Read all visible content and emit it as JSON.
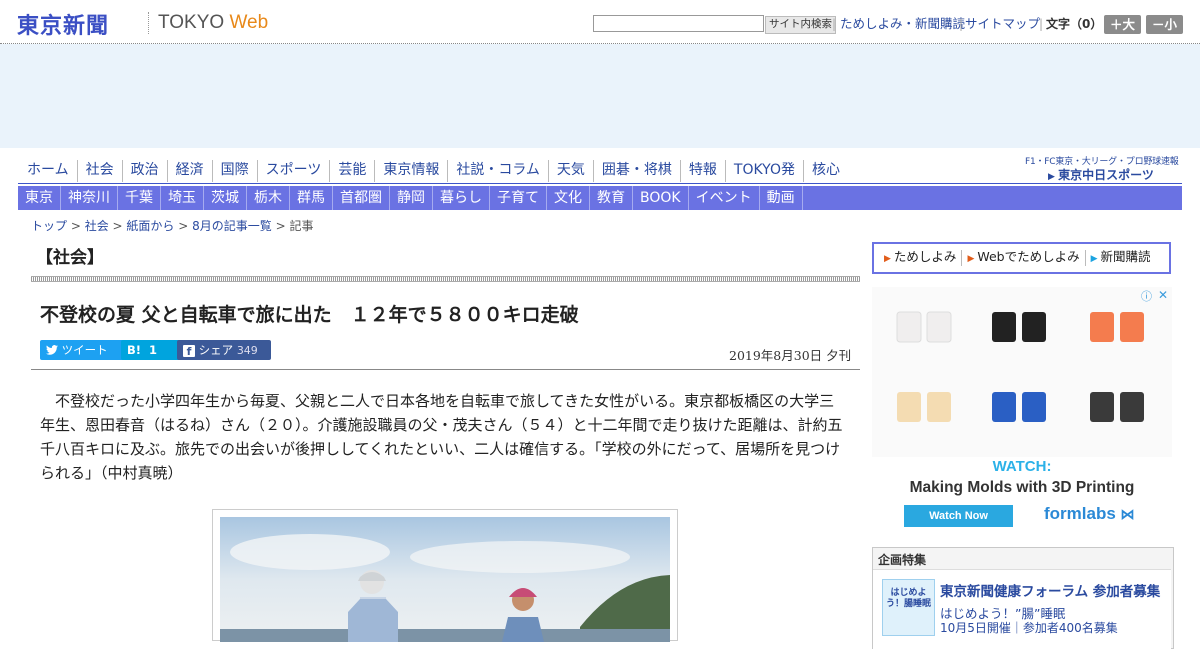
{
  "header": {
    "logo_jp": "東京新聞",
    "logo_en_1": "TOKYO",
    "logo_en_2": " Web",
    "search_placeholder": "",
    "search_button": "サイト内検索",
    "links": [
      "ためしよみ・新聞購読",
      "サイトマップ"
    ],
    "font_label": "文字（0）",
    "font_bigger": "＋大",
    "font_smaller": "－小"
  },
  "nav_primary": [
    "ホーム",
    "社会",
    "政治",
    "経済",
    "国際",
    "スポーツ",
    "芸能",
    "東京情報",
    "社説・コラム",
    "天気",
    "囲碁・将棋",
    "特報",
    "TOKYO発",
    "核心"
  ],
  "nav_regional": [
    "東京",
    "神奈川",
    "千葉",
    "埼玉",
    "茨城",
    "栃木",
    "群馬",
    "首都圏",
    "静岡",
    "暮らし",
    "子育て",
    "文化",
    "教育",
    "BOOK",
    "イベント",
    "動画"
  ],
  "sports_banner": {
    "tagline": "F1・FC東京・大リーグ・プロ野球速報",
    "name": "東京中日スポーツ"
  },
  "breadcrumb": {
    "items": [
      "トップ",
      "社会",
      "紙面から",
      "8月の記事一覧"
    ],
    "current": "記事",
    "separator": " > "
  },
  "article": {
    "section": "【社会】",
    "headline": "不登校の夏 父と自転車で旅に出た　１２年で５８００キロ走破",
    "share": {
      "tweet": "ツイート",
      "hatena_count": "1",
      "share_label": "シェア",
      "share_count": "349"
    },
    "date": "2019年8月30日 夕刊",
    "lead": "不登校だった小学四年生から毎夏、父親と二人で日本各地を自転車で旅してきた女性がいる。東京都板橋区の大学三年生、恩田春音（はるね）さん（２０）。介護施設職員の父・茂夫さん（５４）と十二年間で走り抜けた距離は、計約五千八百キロに及ぶ。旅先での出会いが後押ししてくれたといい、二人は確信する。「学校の外にだって、居場所を見つけられる」（中村真暁）"
  },
  "sidebar": {
    "subscribe_links": [
      "ためしよみ",
      "Webでためしよみ",
      "新聞購読"
    ],
    "ad": {
      "watch": "WATCH:",
      "title": "Making Molds with 3D Printing",
      "cta": "Watch Now",
      "brand": "formlabs"
    },
    "feature": {
      "heading": "企画特集",
      "thumb_text": "はじめよう！腸睡眠",
      "title": "東京新聞健康フォーラム 参加者募集",
      "subtitle": "はじめよう！”腸”睡眠",
      "detail": "10月5日開催｜参加者400名募集"
    }
  },
  "colors": {
    "brand_blue": "#3b4fc4",
    "nav_bar": "#6a72e3",
    "link": "#2a4a9f",
    "ad_bg": "#eaf3fb"
  }
}
